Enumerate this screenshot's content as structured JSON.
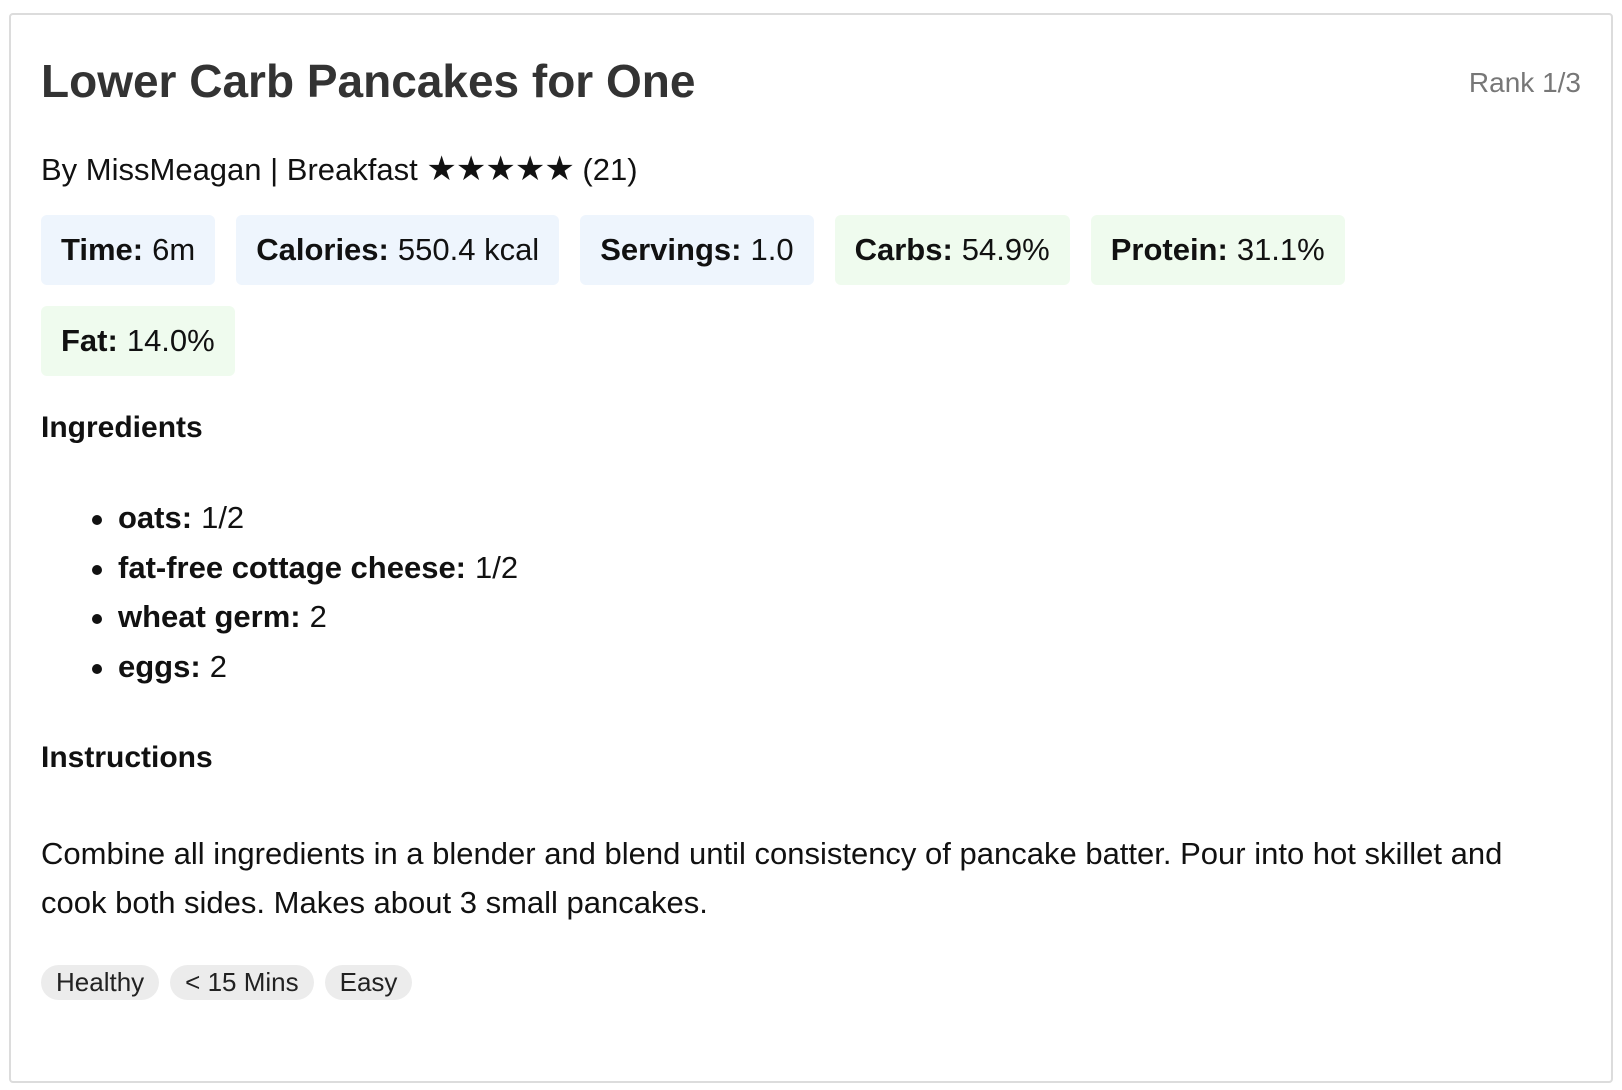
{
  "recipe": {
    "title": "Lower Carb Pancakes for One",
    "rank": "Rank 1/3",
    "byline": "By MissMeagan | Breakfast",
    "rating": {
      "stars_text": "★★★★★",
      "stars": 5,
      "count_text": "(21)"
    }
  },
  "stats": [
    {
      "label": "Time:",
      "value": "6m",
      "tone": "blue"
    },
    {
      "label": "Calories:",
      "value": "550.4 kcal",
      "tone": "blue"
    },
    {
      "label": "Servings:",
      "value": "1.0",
      "tone": "blue"
    },
    {
      "label": "Carbs:",
      "value": "54.9%",
      "tone": "green"
    },
    {
      "label": "Protein:",
      "value": "31.1%",
      "tone": "green"
    },
    {
      "label": "Fat:",
      "value": "14.0%",
      "tone": "green"
    }
  ],
  "ingredients": {
    "heading": "Ingredients",
    "items": [
      {
        "name": "oats:",
        "amount": "1/2"
      },
      {
        "name": "fat-free cottage cheese:",
        "amount": "1/2"
      },
      {
        "name": "wheat germ:",
        "amount": "2"
      },
      {
        "name": "eggs:",
        "amount": "2"
      }
    ]
  },
  "instructions": {
    "heading": "Instructions",
    "text": "Combine all ingredients in a blender and blend until consistency of pancake batter. Pour into hot skillet and cook both sides. Makes about 3 small pancakes."
  },
  "tags": [
    "Healthy",
    "< 15 Mins",
    "Easy"
  ],
  "colors": {
    "chip_blue": "#eef5fd",
    "chip_green": "#effbee",
    "tag_bg": "#ececec",
    "title": "#333333",
    "rank": "#777777"
  }
}
